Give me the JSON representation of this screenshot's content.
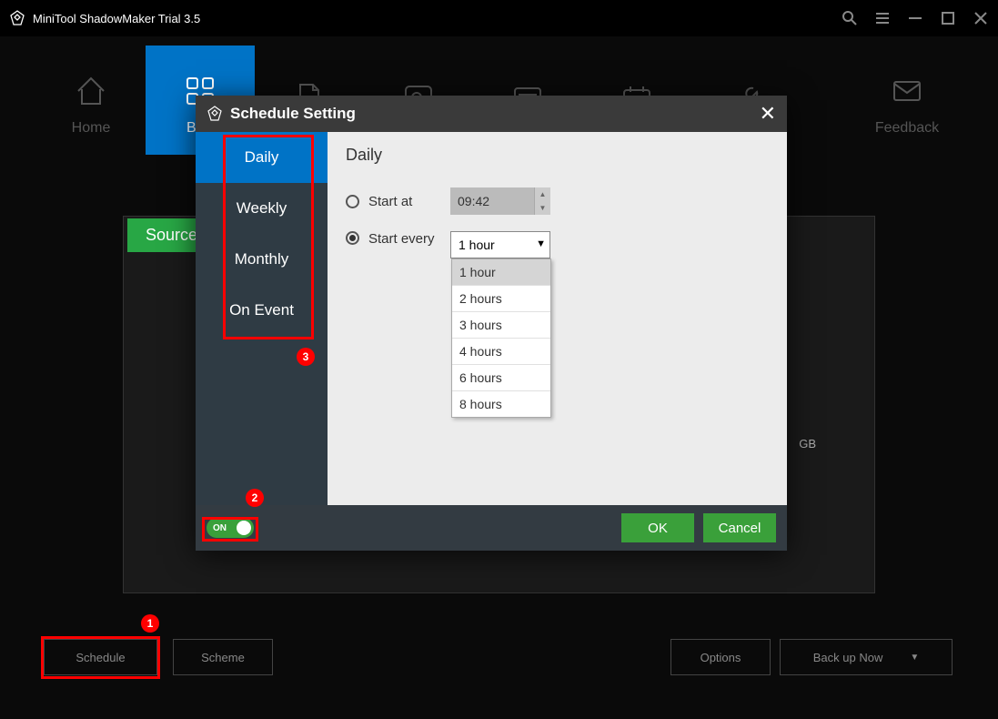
{
  "titlebar": {
    "title": "MiniTool ShadowMaker Trial 3.5"
  },
  "nav": {
    "items": [
      {
        "label": "Home"
      },
      {
        "label": "Backup"
      },
      {
        "label": ""
      },
      {
        "label": ""
      },
      {
        "label": ""
      },
      {
        "label": ""
      },
      {
        "label": ""
      },
      {
        "label": "Feedback"
      }
    ]
  },
  "main": {
    "source_label": "Source",
    "gb_text": "GB"
  },
  "bottom": {
    "schedule": "Schedule",
    "scheme": "Scheme",
    "options": "Options",
    "backup": "Back up Now"
  },
  "dialog": {
    "title": "Schedule Setting",
    "tabs": [
      "Daily",
      "Weekly",
      "Monthly",
      "On Event"
    ],
    "content": {
      "heading": "Daily",
      "start_at_label": "Start at",
      "start_at_value": "09:42",
      "start_every_label": "Start every",
      "start_every_value": "1 hour",
      "options": [
        "1 hour",
        "2 hours",
        "3 hours",
        "4 hours",
        "6 hours",
        "8 hours"
      ]
    },
    "toggle": "ON",
    "ok": "OK",
    "cancel": "Cancel"
  },
  "annotations": {
    "n1": "1",
    "n2": "2",
    "n3": "3"
  }
}
